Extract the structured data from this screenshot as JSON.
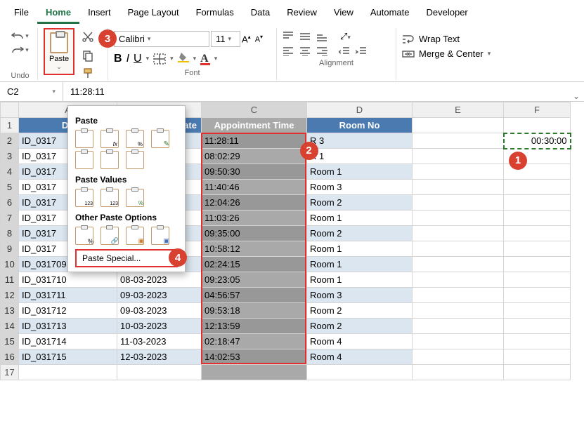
{
  "menu": {
    "items": [
      "File",
      "Home",
      "Insert",
      "Page Layout",
      "Formulas",
      "Data",
      "Review",
      "View",
      "Automate",
      "Developer"
    ]
  },
  "ribbon": {
    "undo_label": "Undo",
    "paste_label": "Paste",
    "font_name": "Calibri",
    "font_size": "11",
    "bold": "B",
    "italic": "I",
    "underline": "U",
    "font_group": "Font",
    "align_group": "Alignment",
    "wrap": "Wrap Text",
    "merge": "Merge & Center"
  },
  "namebox": "C2",
  "formula": "11:28:11",
  "columns": [
    "A",
    "B",
    "C",
    "D",
    "E",
    "F"
  ],
  "headers": {
    "C": "Appointment Time",
    "D": "Room No"
  },
  "partial_headers": {
    "A": "Do",
    "B": "t Date"
  },
  "rows": [
    {
      "r": 2,
      "A": "ID_0317",
      "B": "",
      "C": "11:28:11",
      "D": "R         3"
    },
    {
      "r": 3,
      "A": "ID_0317",
      "B": "",
      "C": "08:02:29",
      "D": "R         1"
    },
    {
      "r": 4,
      "A": "ID_0317",
      "B": "",
      "C": "09:50:30",
      "D": "Room 1"
    },
    {
      "r": 5,
      "A": "ID_0317",
      "B": "",
      "C": "11:40:46",
      "D": "Room 3"
    },
    {
      "r": 6,
      "A": "ID_0317",
      "B": "",
      "C": "12:04:26",
      "D": "Room 2"
    },
    {
      "r": 7,
      "A": "ID_0317",
      "B": "",
      "C": "11:03:26",
      "D": "Room 1"
    },
    {
      "r": 8,
      "A": "ID_0317",
      "B": "",
      "C": "09:35:00",
      "D": "Room 2"
    },
    {
      "r": 9,
      "A": "ID_0317",
      "B": "",
      "C": "10:58:12",
      "D": "Room 1"
    },
    {
      "r": 10,
      "A": "ID_031709",
      "B": "08-03-2023",
      "C": "02:24:15",
      "D": "Room 1"
    },
    {
      "r": 11,
      "A": "ID_031710",
      "B": "08-03-2023",
      "C": "09:23:05",
      "D": "Room 1"
    },
    {
      "r": 12,
      "A": "ID_031711",
      "B": "09-03-2023",
      "C": "04:56:57",
      "D": "Room 3"
    },
    {
      "r": 13,
      "A": "ID_031712",
      "B": "09-03-2023",
      "C": "09:53:18",
      "D": "Room 2"
    },
    {
      "r": 14,
      "A": "ID_031713",
      "B": "10-03-2023",
      "C": "12:13:59",
      "D": "Room 2"
    },
    {
      "r": 15,
      "A": "ID_031714",
      "B": "11-03-2023",
      "C": "02:18:47",
      "D": "Room 4"
    },
    {
      "r": 16,
      "A": "ID_031715",
      "B": "12-03-2023",
      "C": "14:02:53",
      "D": "Room 4"
    }
  ],
  "f2_value": "00:30:00",
  "paste_popup": {
    "paste": "Paste",
    "values": "Paste Values",
    "other": "Other Paste Options",
    "special": "Paste Special..."
  },
  "badges": {
    "b1": "1",
    "b2": "2",
    "b3": "3",
    "b4": "4"
  }
}
